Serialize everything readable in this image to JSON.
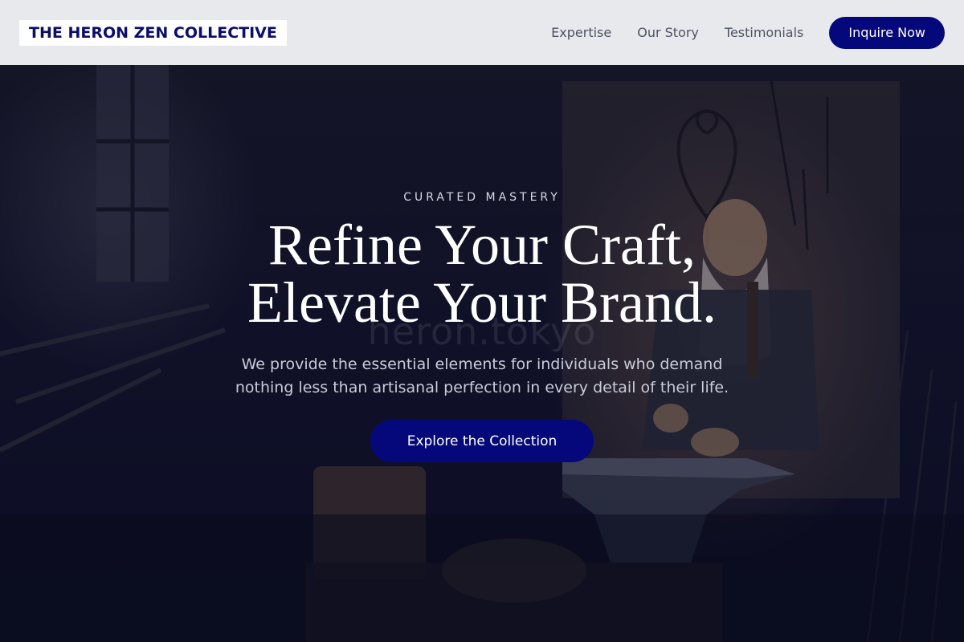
{
  "header": {
    "logo_text": "THE HERON ZEN COLLECTIVE",
    "nav": [
      {
        "label": "Expertise"
      },
      {
        "label": "Our Story"
      },
      {
        "label": "Testimonials"
      }
    ],
    "cta_label": "Inquire Now"
  },
  "hero": {
    "eyebrow": "CURATED MASTERY",
    "headline_line1": "Refine Your Craft,",
    "headline_line2": "Elevate Your Brand.",
    "subtitle": "We provide the essential elements for individuals who demand nothing less than artisanal perfection in every detail of their life.",
    "cta_label": "Explore the Collection",
    "watermark": "heron.tokyo"
  },
  "colors": {
    "brand_navy": "#05087a",
    "header_bg": "#e8e9ec",
    "hero_overlay": "#080a24"
  },
  "background_image": "blacksmith-workshop-photo"
}
